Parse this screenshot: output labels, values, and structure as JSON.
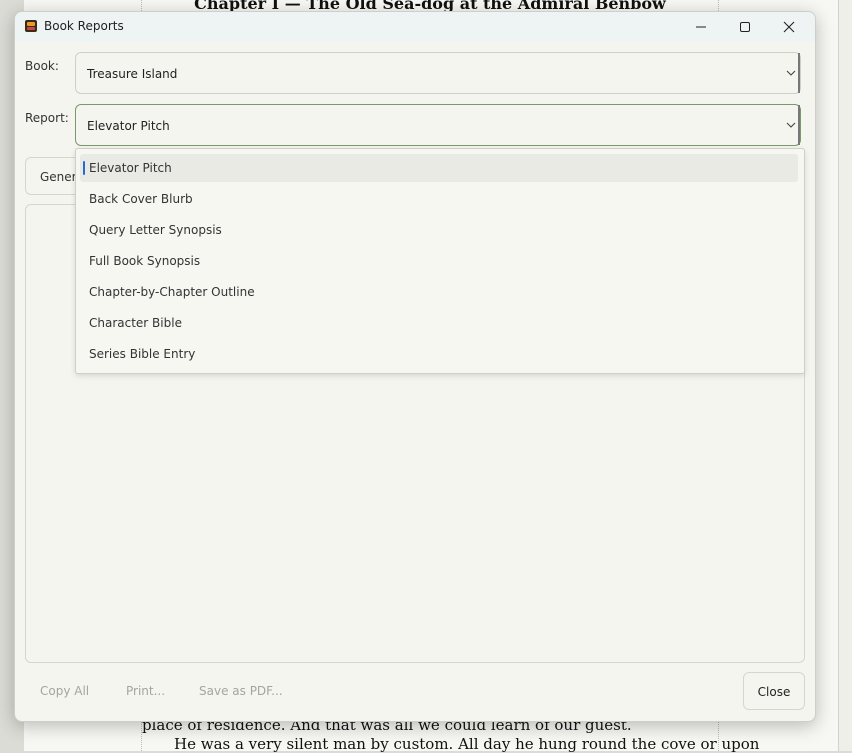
{
  "background": {
    "heading": "Chapter I — The Old Sea-dog at the Admiral Benbow",
    "line1": "place of residence. And that was all we could learn of our guest.",
    "line2": "He was a very silent man by custom. All day he hung round the cove or upon"
  },
  "window": {
    "title": "Book Reports",
    "controls": {
      "minimize": "minimize-icon",
      "maximize": "maximize-icon",
      "close": "close-icon"
    }
  },
  "form": {
    "book_label": "Book:",
    "book_value": "Treasure Island",
    "report_label": "Report:",
    "report_value": "Elevator Pitch",
    "generate_label": "Gener"
  },
  "report_options": [
    "Elevator Pitch",
    "Back Cover Blurb",
    "Query Letter Synopsis",
    "Full Book Synopsis",
    "Chapter-by-Chapter Outline",
    "Character Bible",
    "Series Bible Entry"
  ],
  "footer": {
    "copy_all": "Copy All",
    "print": "Print...",
    "save_pdf": "Save as PDF...",
    "close": "Close"
  },
  "colors": {
    "accent": "#2a6ad0",
    "focus_border": "#7a9a6a",
    "disabled_text": "#a5a5a0"
  }
}
